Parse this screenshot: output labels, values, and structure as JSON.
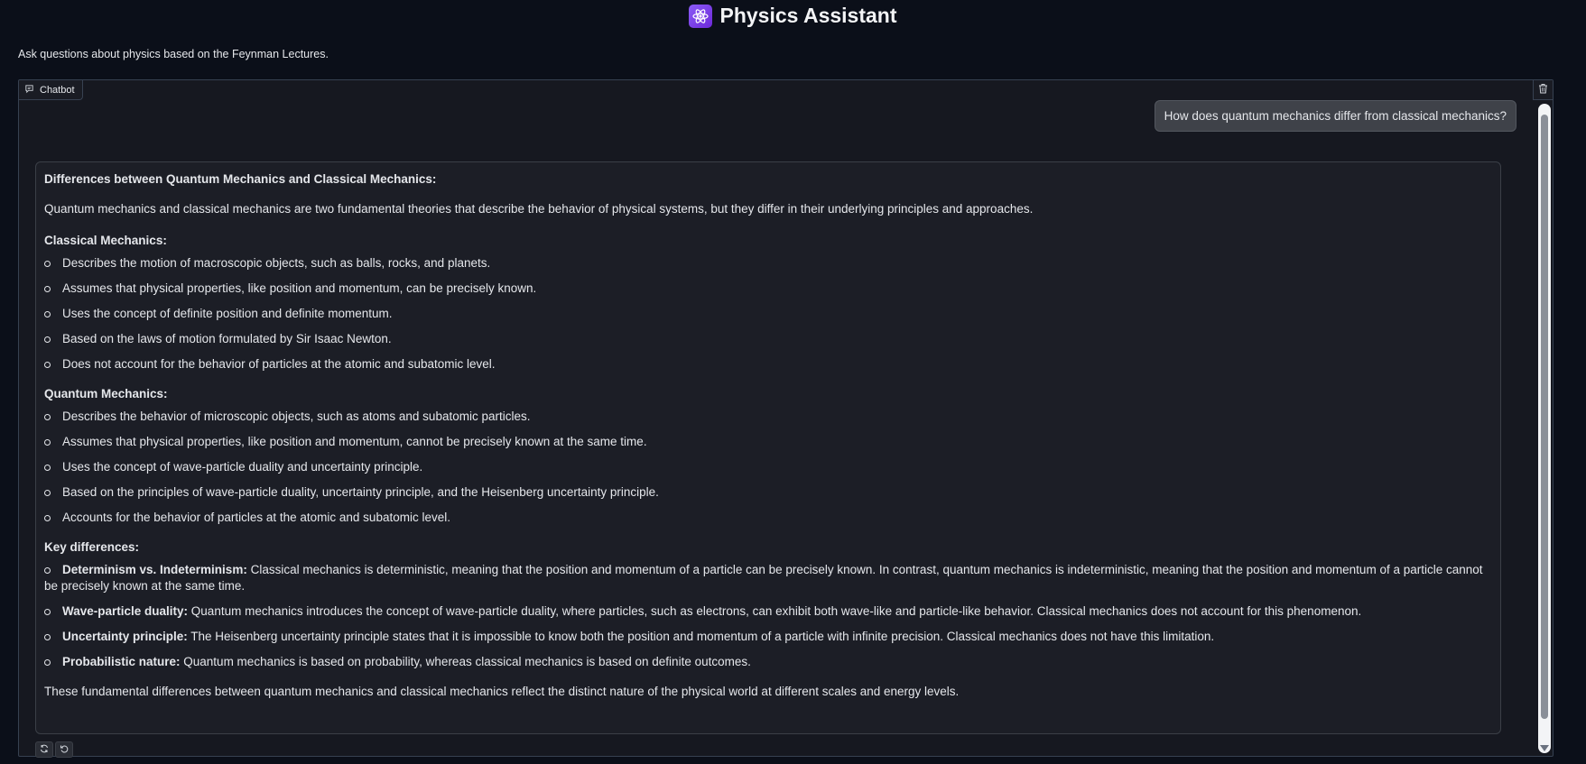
{
  "header": {
    "title": "Physics Assistant",
    "subtitle": "Ask questions about physics based on the Feynman Lectures."
  },
  "chatbot": {
    "label": "Chatbot",
    "user_message": "How does quantum mechanics differ from classical mechanics?",
    "response": {
      "heading": "Differences between Quantum Mechanics and Classical Mechanics:",
      "intro": "Quantum mechanics and classical mechanics are two fundamental theories that describe the behavior of physical systems, but they differ in their underlying principles and approaches.",
      "classical": {
        "heading": "Classical Mechanics:",
        "items": [
          "Describes the motion of macroscopic objects, such as balls, rocks, and planets.",
          "Assumes that physical properties, like position and momentum, can be precisely known.",
          "Uses the concept of definite position and definite momentum.",
          "Based on the laws of motion formulated by Sir Isaac Newton.",
          "Does not account for the behavior of particles at the atomic and subatomic level."
        ]
      },
      "quantum": {
        "heading": "Quantum Mechanics:",
        "items": [
          "Describes the behavior of microscopic objects, such as atoms and subatomic particles.",
          "Assumes that physical properties, like position and momentum, cannot be precisely known at the same time.",
          "Uses the concept of wave-particle duality and uncertainty principle.",
          "Based on the principles of wave-particle duality, uncertainty principle, and the Heisenberg uncertainty principle.",
          "Accounts for the behavior of particles at the atomic and subatomic level."
        ]
      },
      "key": {
        "heading": "Key differences:",
        "items": [
          {
            "term": "Determinism vs. Indeterminism:",
            "text": " Classical mechanics is deterministic, meaning that the position and momentum of a particle can be precisely known. In contrast, quantum mechanics is indeterministic, meaning that the position and momentum of a particle cannot be precisely known at the same time."
          },
          {
            "term": "Wave-particle duality:",
            "text": " Quantum mechanics introduces the concept of wave-particle duality, where particles, such as electrons, can exhibit both wave-like and particle-like behavior. Classical mechanics does not account for this phenomenon."
          },
          {
            "term": "Uncertainty principle:",
            "text": " The Heisenberg uncertainty principle states that it is impossible to know both the position and momentum of a particle with infinite precision. Classical mechanics does not have this limitation."
          },
          {
            "term": "Probabilistic nature:",
            "text": " Quantum mechanics is based on probability, whereas classical mechanics is based on definite outcomes."
          }
        ]
      },
      "conclusion": "These fundamental differences between quantum mechanics and classical mechanics reflect the distinct nature of the physical world at different scales and energy levels."
    }
  },
  "icons": {
    "logo": "atom-icon",
    "label": "chat-icon",
    "clear": "trash-icon",
    "retry": "refresh-icon",
    "undo": "undo-icon"
  },
  "colors": {
    "background": "#0b0f19",
    "panel": "#161820",
    "accent": "#8b5cf6"
  }
}
